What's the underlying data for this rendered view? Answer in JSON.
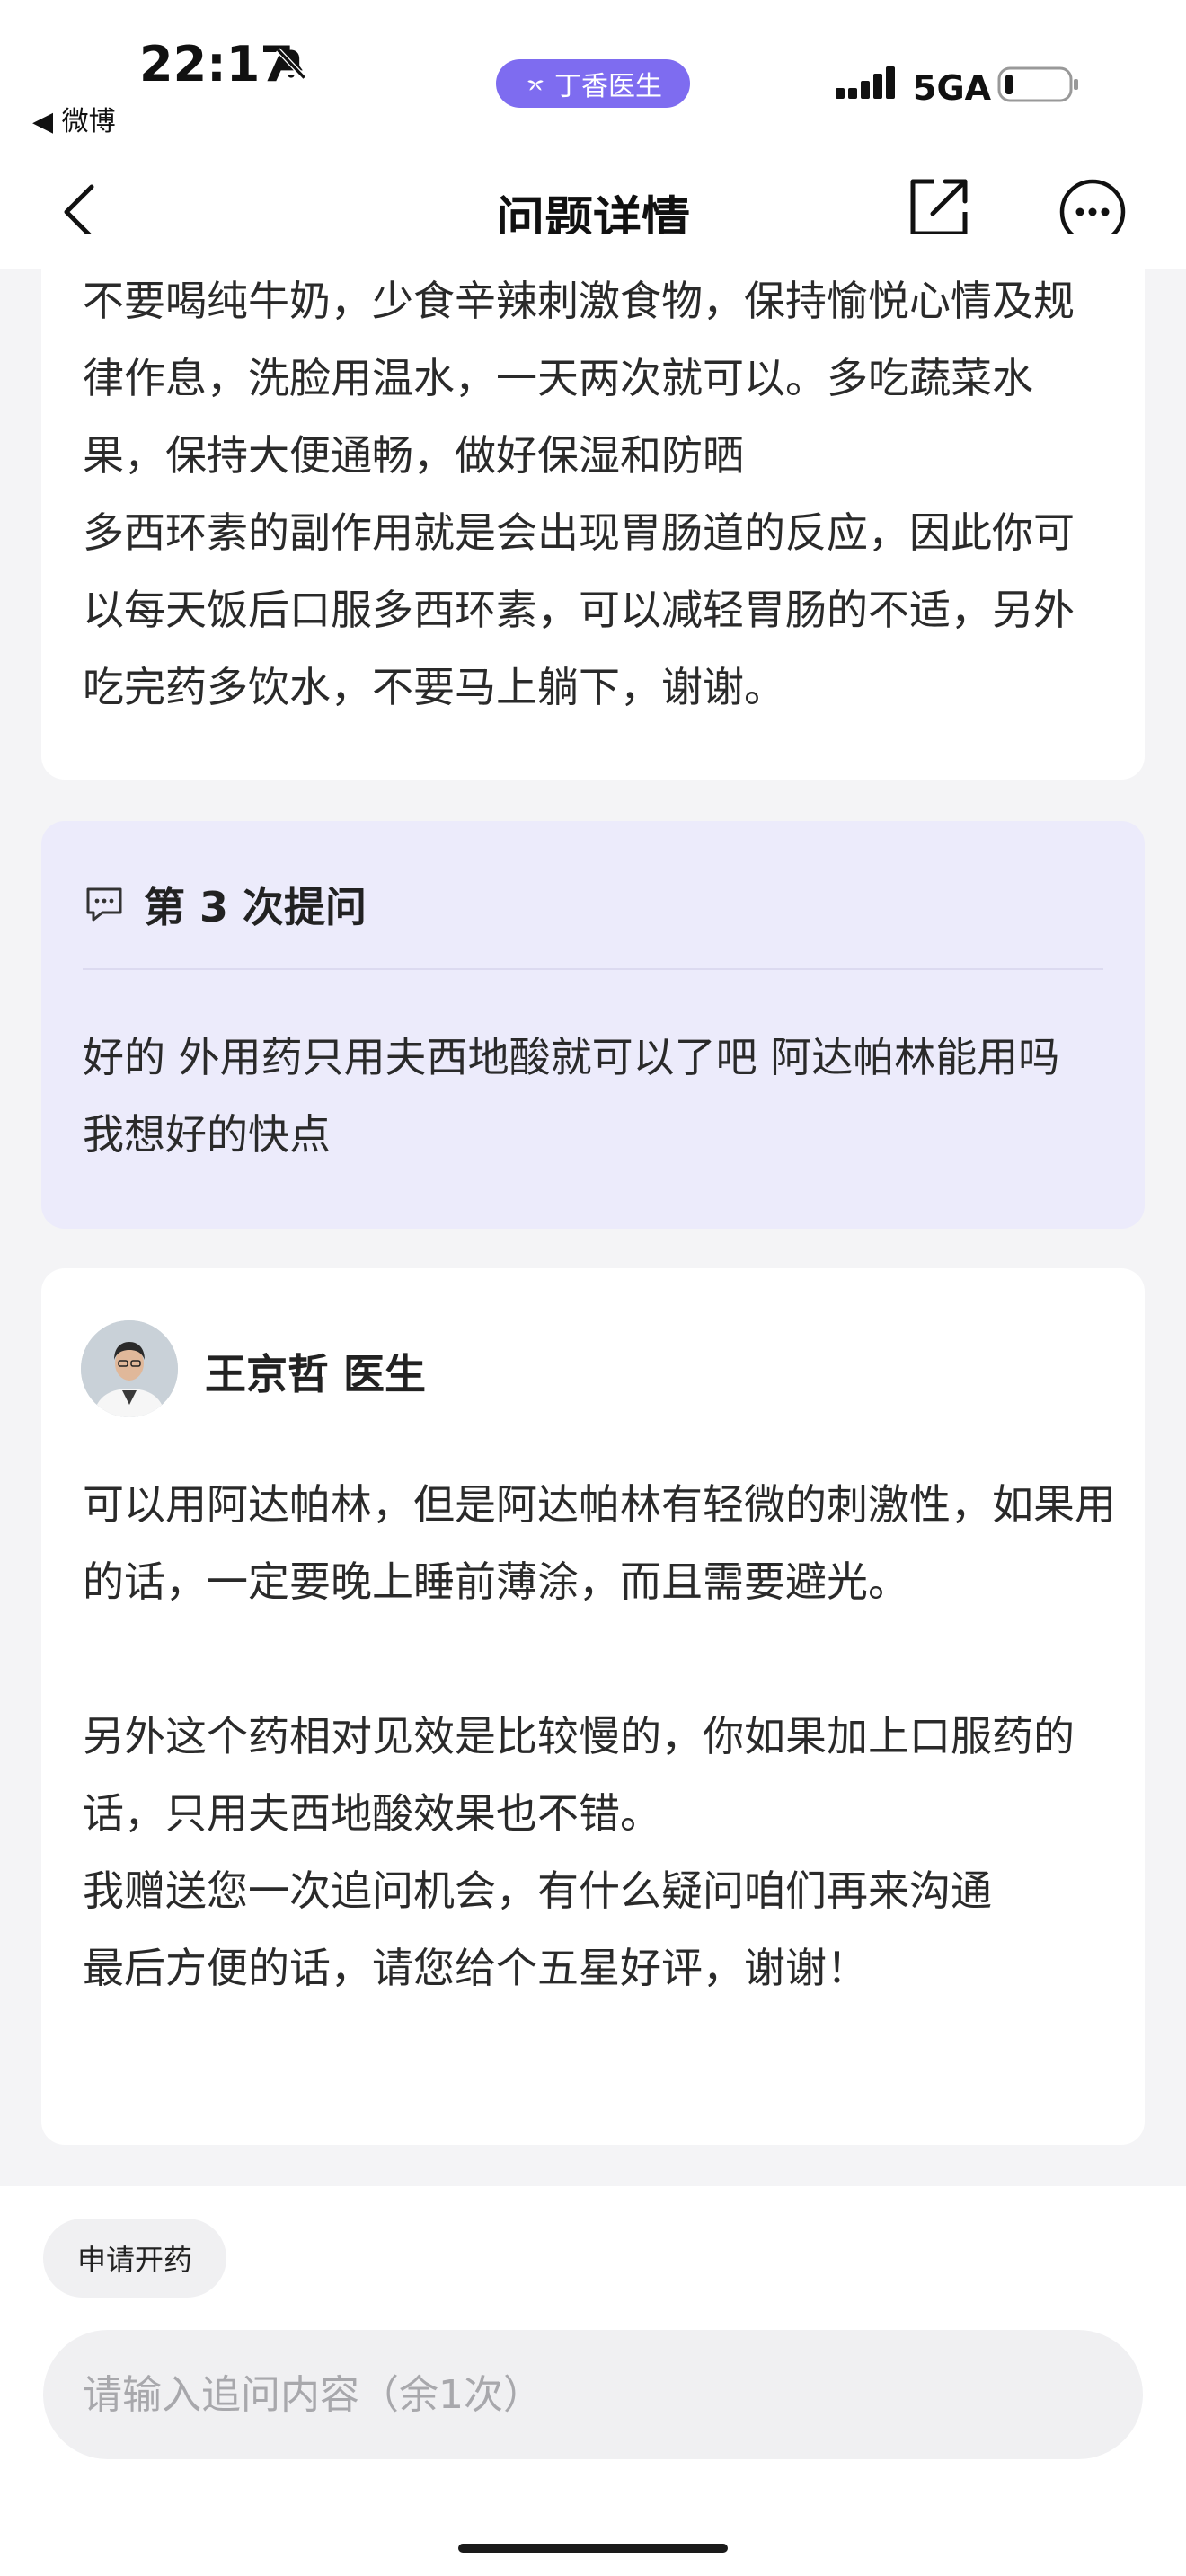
{
  "status_bar": {
    "time": "22:17",
    "back_app": "◀ 微博",
    "app_badge": "丁香医生",
    "network": "5GA"
  },
  "nav": {
    "title": "问题详情"
  },
  "previous_answer": {
    "paragraphs": [
      "不要喝纯牛奶，少食辛辣刺激食物，保持愉悦心情及规律作息，洗脸用温水，一天两次就可以。多吃蔬菜水果，保持大便通畅，做好保湿和防晒",
      "多西环素的副作用就是会出现胃肠道的反应，因此你可以每天饭后口服多西环素，可以减轻胃肠的不适，另外吃完药多饮水，不要马上躺下，谢谢。"
    ]
  },
  "question": {
    "title": "第 3 次提问",
    "text": "好的 外用药只用夫西地酸就可以了吧 阿达帕林能用吗 我想好的快点"
  },
  "doctor_reply": {
    "name": "王京哲 医生",
    "paragraphs": [
      "可以用阿达帕林，但是阿达帕林有轻微的刺激性，如果用的话，一定要晚上睡前薄涂，而且需要避光。",
      "另外这个药相对见效是比较慢的，你如果加上口服药的话，只用夫西地酸效果也不错。",
      "我赠送您一次追问机会，有什么疑问咱们再来沟通",
      "最后方便的话，请您给个五星好评，谢谢！"
    ]
  },
  "bottom": {
    "prescription_button": "申请开药",
    "input_placeholder": "请输入追问内容（余1次）"
  },
  "colors": {
    "accent": "#7e6cf0",
    "question_bg": "#ecebfb",
    "page_bg": "#f4f4f6"
  }
}
